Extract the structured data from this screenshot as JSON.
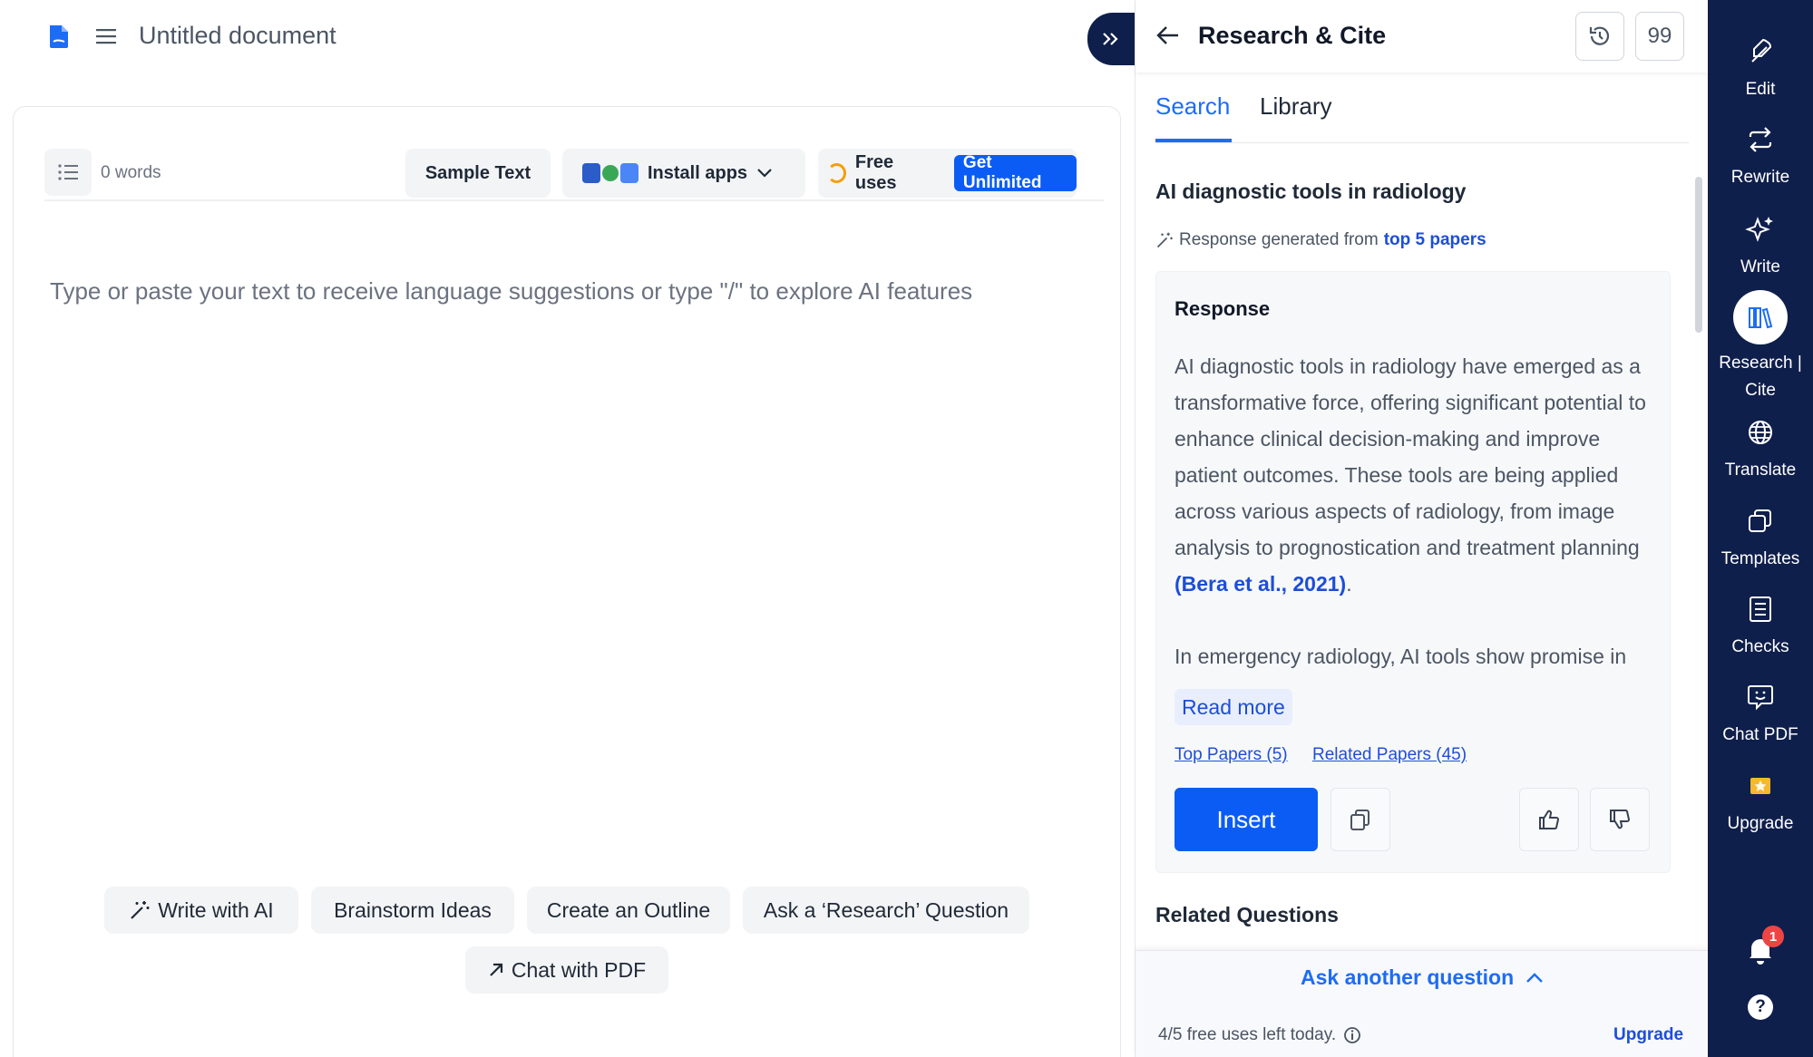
{
  "document": {
    "title": "Untitled document",
    "word_count": "0 words",
    "placeholder": "Type or paste your text to receive language suggestions or type \"/\" to explore AI features"
  },
  "toolbar": {
    "sample_text": "Sample Text",
    "install_apps": "Install apps",
    "free_uses": "Free uses",
    "get_unlimited": "Get Unlimited"
  },
  "ai_actions": {
    "write_with_ai": "Write with AI",
    "brainstorm": "Brainstorm Ideas",
    "outline": "Create an Outline",
    "research_question": "Ask a ‘Research’ Question",
    "chat_pdf": "Chat with PDF"
  },
  "panel": {
    "title": "Research & Cite",
    "cite_button": "99",
    "tabs": {
      "search": "Search",
      "library": "Library"
    },
    "query": "AI diagnostic tools in radiology",
    "generated_prefix": "Response generated from",
    "generated_link": "top 5 papers",
    "response": {
      "heading": "Response",
      "paragraph1": "AI diagnostic tools in radiology have emerged as a transformative force, offering significant potential to enhance clinical decision-making and improve patient outcomes. These tools are being applied across various aspects of radiology, from image analysis to prognostication and treatment planning ",
      "citation": "(Bera et al., 2021)",
      "paragraph1_end": ".",
      "paragraph2": "In emergency radiology, AI tools show promise in",
      "read_more": "Read more",
      "top_papers": "Top Papers (5)",
      "related_papers": "Related Papers (45)",
      "insert": "Insert"
    },
    "related_questions": "Related Questions",
    "ask_another": "Ask another question",
    "uses_left": "4/5 free uses left today.",
    "upgrade": "Upgrade"
  },
  "sidebar": {
    "items": [
      {
        "label": "Edit",
        "icon": "feather-icon"
      },
      {
        "label": "Rewrite",
        "icon": "repeat-icon"
      },
      {
        "label": "Write",
        "icon": "sparkle-icon"
      },
      {
        "label": "Research | Cite",
        "icon": "books-icon"
      },
      {
        "label": "Translate",
        "icon": "globe-icon"
      },
      {
        "label": "Templates",
        "icon": "templates-icon"
      },
      {
        "label": "Checks",
        "icon": "checklist-icon"
      },
      {
        "label": "Chat PDF",
        "icon": "chat-icon"
      },
      {
        "label": "Upgrade",
        "icon": "star-icon"
      }
    ],
    "notification_count": "1",
    "help": "?"
  },
  "colors": {
    "accent": "#0a5cf5",
    "sidebar_bg": "#0f1f4b",
    "link": "#1d4ed8"
  }
}
